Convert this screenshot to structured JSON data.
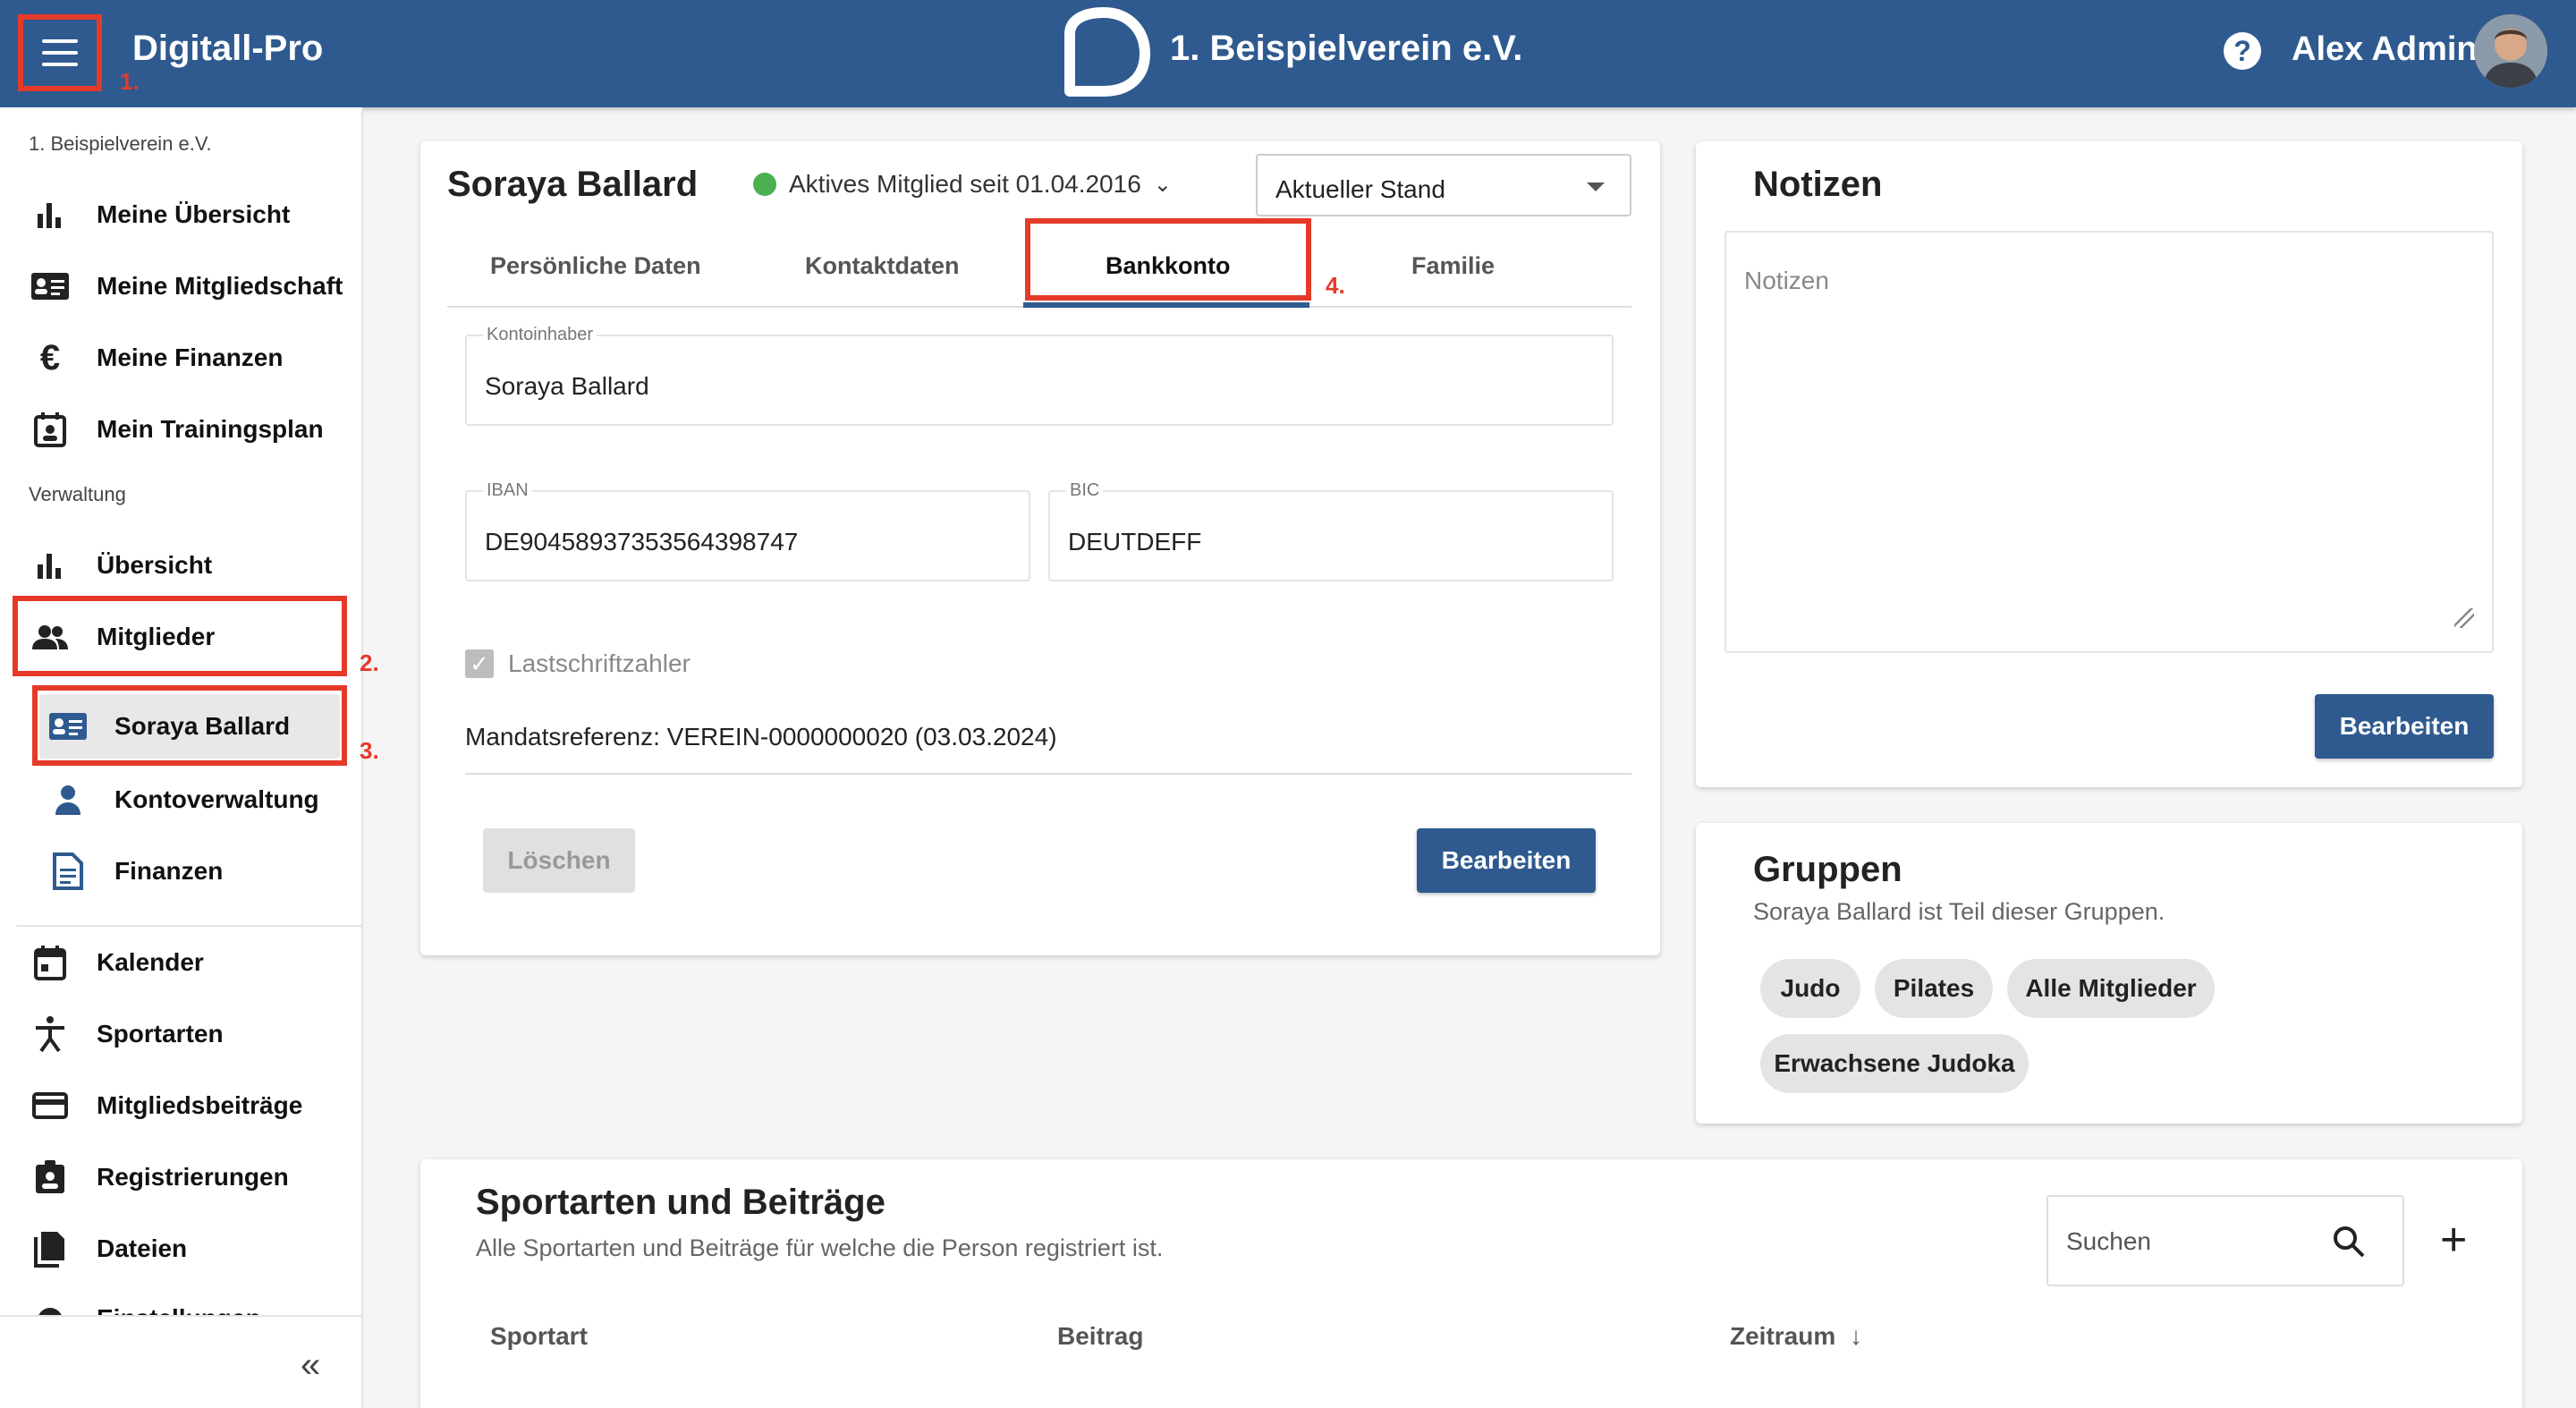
{
  "header": {
    "app_name": "Digitall-Pro",
    "club_name": "1. Beispielverein e.V.",
    "user_name": "Alex Admin"
  },
  "annotations": [
    "1.",
    "2.",
    "3.",
    "4."
  ],
  "sidebar": {
    "club_label": "1. Beispielverein e.V.",
    "personal_items": [
      {
        "label": "Meine Übersicht",
        "icon": "bar-chart-icon"
      },
      {
        "label": "Meine Mitgliedschaft",
        "icon": "id-card-icon"
      },
      {
        "label": "Meine Finanzen",
        "icon": "euro-icon"
      },
      {
        "label": "Mein Trainingsplan",
        "icon": "calendar-person-icon"
      }
    ],
    "admin_label": "Verwaltung",
    "admin_items": [
      {
        "label": "Übersicht",
        "icon": "bar-chart-icon"
      },
      {
        "label": "Mitglieder",
        "icon": "people-icon"
      }
    ],
    "member_sub_items": [
      {
        "label": "Soraya Ballard",
        "icon": "id-card-icon"
      },
      {
        "label": "Kontoverwaltung",
        "icon": "person-icon"
      },
      {
        "label": "Finanzen",
        "icon": "document-icon"
      }
    ],
    "other_items": [
      {
        "label": "Kalender",
        "icon": "calendar-icon"
      },
      {
        "label": "Sportarten",
        "icon": "sport-icon"
      },
      {
        "label": "Mitgliedsbeiträge",
        "icon": "credit-card-icon"
      },
      {
        "label": "Registrierungen",
        "icon": "badge-icon"
      },
      {
        "label": "Dateien",
        "icon": "files-icon"
      },
      {
        "label": "Einstellungen",
        "icon": "gear-icon"
      }
    ]
  },
  "member": {
    "name": "Soraya Ballard",
    "status": "Aktives Mitglied seit 01.04.2016",
    "view_select": "Aktueller Stand",
    "tabs": [
      "Persönliche Daten",
      "Kontaktdaten",
      "Bankkonto",
      "Familie"
    ],
    "active_tab": "Bankkonto",
    "bank": {
      "holder_label": "Kontoinhaber",
      "holder_value": "Soraya Ballard",
      "iban_label": "IBAN",
      "iban_value": "DE90458937353564398747",
      "bic_label": "BIC",
      "bic_value": "DEUTDEFF",
      "direct_debit_label": "Lastschriftzahler",
      "direct_debit_checked": true,
      "mandate": "Mandatsreferenz: VEREIN-0000000020 (03.03.2024)"
    },
    "delete_label": "Löschen",
    "edit_label": "Bearbeiten"
  },
  "notes": {
    "title": "Notizen",
    "placeholder": "Notizen",
    "edit_label": "Bearbeiten"
  },
  "groups": {
    "title": "Gruppen",
    "subtitle": "Soraya Ballard ist Teil dieser Gruppen.",
    "chips": [
      "Judo",
      "Pilates",
      "Alle Mitglieder",
      "Erwachsene Judoka"
    ]
  },
  "sports": {
    "title": "Sportarten und Beiträge",
    "subtitle": "Alle Sportarten und Beiträge für welche die Person registriert ist.",
    "search_placeholder": "Suchen",
    "columns": [
      "Sportart",
      "Beitrag",
      "Zeitraum"
    ],
    "sort_icon": "arrow-down-icon"
  },
  "colors": {
    "primary": "#2f5a8f",
    "highlight": "#e53a2a",
    "status_active": "#4caf50"
  }
}
